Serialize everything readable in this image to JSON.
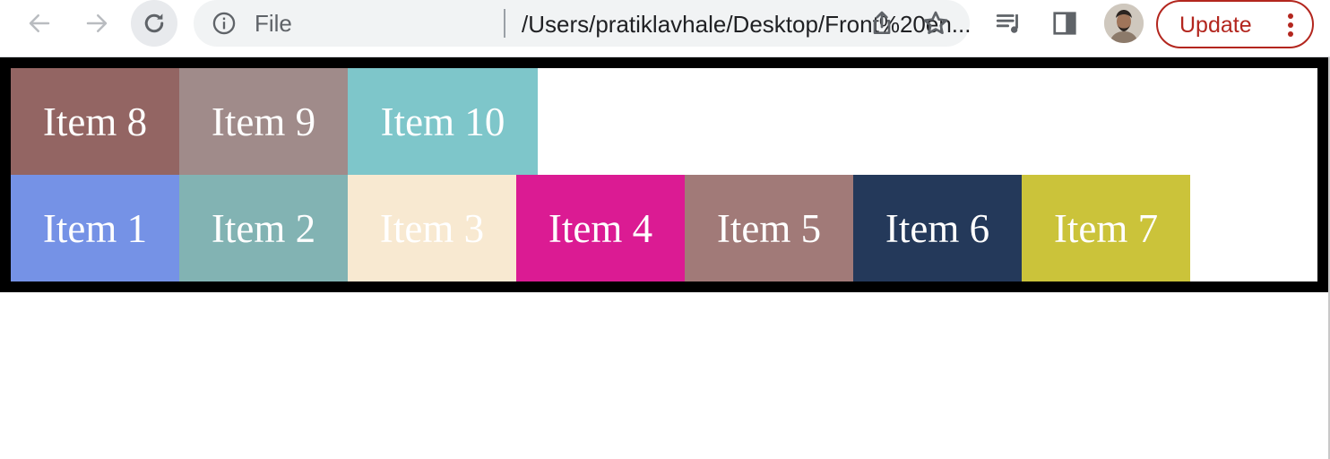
{
  "browser": {
    "back_icon": "arrow-left-icon",
    "forward_icon": "arrow-right-icon",
    "reload_icon": "reload-icon",
    "omnibox": {
      "info_icon": "info-icon",
      "scheme_label": "File",
      "url": "/Users/pratiklavhale/Desktop/Front%20en...",
      "share_icon": "share-icon",
      "bookmark_icon": "star-icon"
    },
    "media_icon": "media-queue-icon",
    "side_panel_icon": "side-panel-icon",
    "update_label": "Update",
    "colors": {
      "update_accent": "#b3261e",
      "omnibox_bg": "#f1f3f4"
    }
  },
  "page": {
    "container_border_color": "#000000",
    "rows": [
      {
        "items": [
          {
            "label": "Item 8",
            "color": "#936563"
          },
          {
            "label": "Item 9",
            "color": "#a08b8a"
          },
          {
            "label": "Item 10",
            "color": "#7ec6ca"
          }
        ]
      },
      {
        "items": [
          {
            "label": "Item 1",
            "color": "#7592e6"
          },
          {
            "label": "Item 2",
            "color": "#82b3b3"
          },
          {
            "label": "Item 3",
            "color": "#f8e9d1"
          },
          {
            "label": "Item 4",
            "color": "#db1b93"
          },
          {
            "label": "Item 5",
            "color": "#a17a78"
          },
          {
            "label": "Item 6",
            "color": "#24395a"
          },
          {
            "label": "Item 7",
            "color": "#cbc33a"
          }
        ]
      }
    ]
  }
}
